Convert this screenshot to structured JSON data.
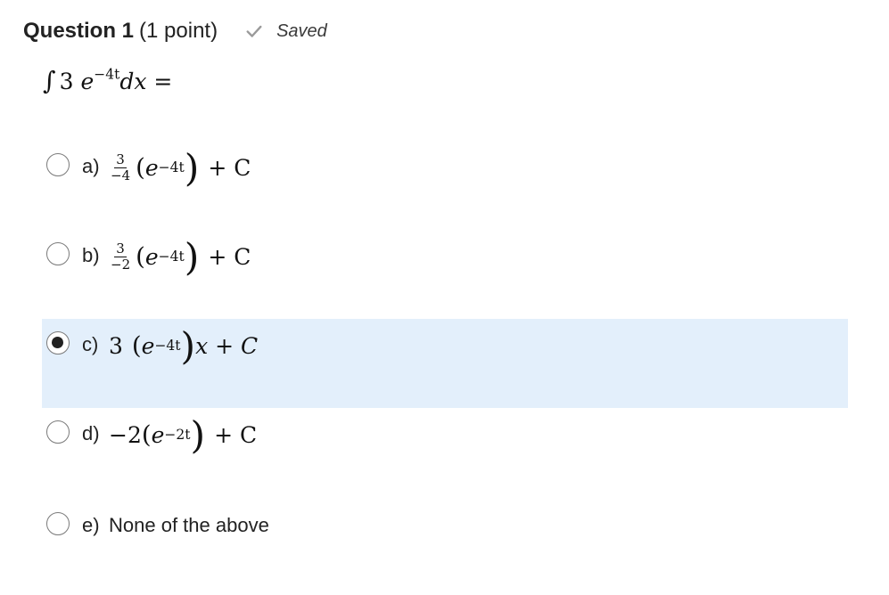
{
  "question": {
    "title": "Question 1",
    "points": "(1 point)",
    "saved_label": "Saved",
    "prompt": {
      "integral_sign": "∫",
      "coef": "3",
      "base": "e",
      "exponent": "−4t",
      "differential": "dx",
      "equals": "="
    }
  },
  "options": [
    {
      "letter": "a)",
      "frac_num": "3",
      "frac_den": "−4",
      "base": "e",
      "exponent": "−4t",
      "tail": "+ C",
      "selected": false
    },
    {
      "letter": "b)",
      "frac_num": "3",
      "frac_den": "−2",
      "base": "e",
      "exponent": "−4t",
      "tail": "+ C",
      "selected": false
    },
    {
      "letter": "c)",
      "coef": "3",
      "base": "e",
      "exponent": "−4t",
      "tail": "x + C",
      "selected": true
    },
    {
      "letter": "d)",
      "coef": "−2",
      "base": "e",
      "exponent": "−2t",
      "tail": "+ C",
      "selected": false
    },
    {
      "letter": "e)",
      "text": "None of the above",
      "selected": false
    }
  ],
  "colors": {
    "selected_background": "#e3effb",
    "saved_check": "#9a9a9a"
  },
  "icons": {
    "saved": "check-icon"
  }
}
